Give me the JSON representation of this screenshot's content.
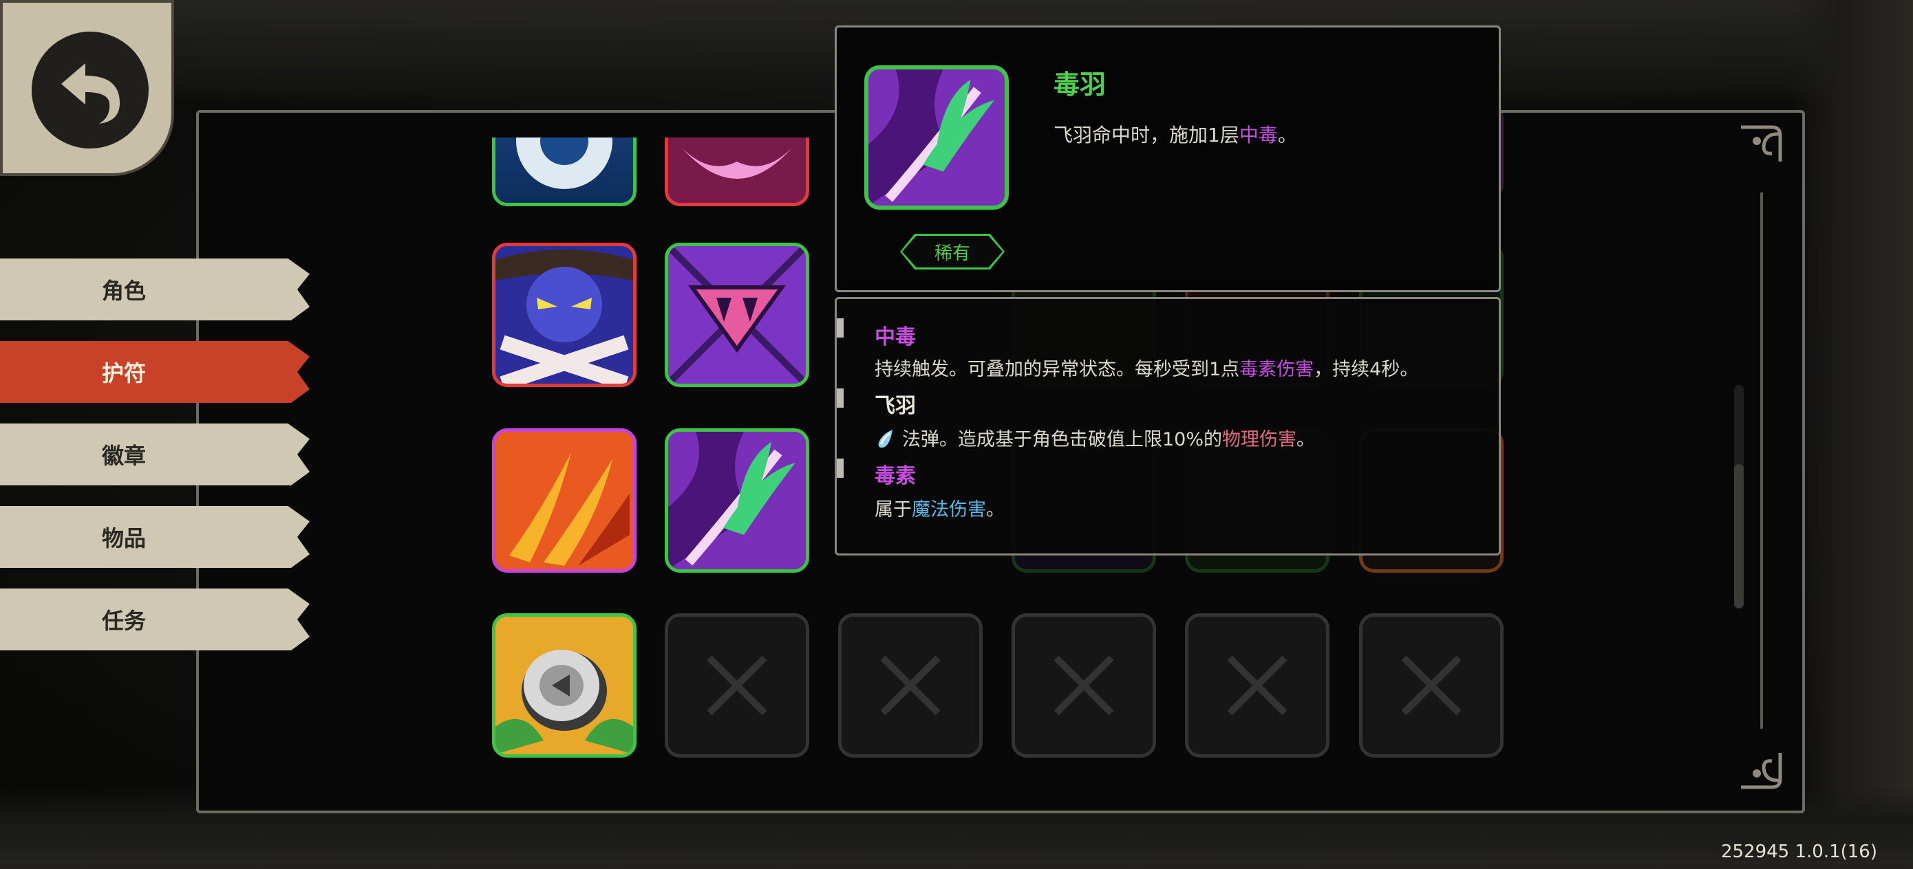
{
  "nav": {
    "tabs": [
      {
        "label": "角色",
        "active": false
      },
      {
        "label": "护符",
        "active": true
      },
      {
        "label": "徽章",
        "active": false
      },
      {
        "label": "物品",
        "active": false
      },
      {
        "label": "任务",
        "active": false
      }
    ]
  },
  "tooltip": {
    "name": "毒羽",
    "desc_prefix": "飞羽命中时，施加1层",
    "desc_keyword": "中毒",
    "desc_suffix": "。",
    "rarity": "稀有",
    "keywords": [
      {
        "title": "中毒",
        "text_a": "持续触发。可叠加的异常状态。每秒受到1点",
        "text_link": "毒素伤害",
        "text_b": "，持续4秒。"
      },
      {
        "title": "飞羽",
        "text_a": "法弹。造成基于角色击破值上限10%的",
        "text_link": "物理伤害",
        "text_b": "。"
      },
      {
        "title": "毒素",
        "text_a": "属于",
        "text_link": "魔法伤害",
        "text_b": "。"
      }
    ]
  },
  "colors": {
    "accent_active_tab": "#c94128",
    "rare_green": "#3ec447",
    "poison_purple": "#c34ee0",
    "physical_pink": "#e06b80",
    "magic_blue": "#58b8e8"
  },
  "footer": {
    "version": "252945 1.0.1(16)"
  }
}
